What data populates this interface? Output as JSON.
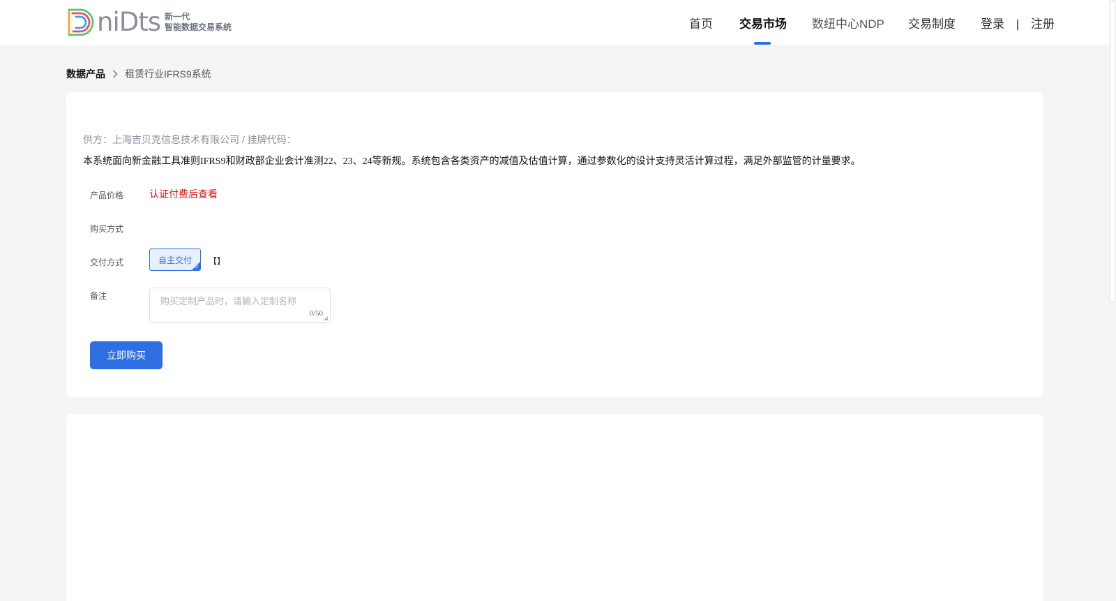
{
  "header": {
    "logo": {
      "word": "niDts",
      "tagline_line1": "新一代",
      "tagline_line2": "智能数据交易系统"
    },
    "nav": [
      {
        "label": "首页"
      },
      {
        "label": "交易市场",
        "active": true
      },
      {
        "label": "数纽中心NDP"
      },
      {
        "label": "交易制度"
      }
    ],
    "auth": {
      "login": "登录",
      "separator": "|",
      "register": "注册"
    }
  },
  "breadcrumb": {
    "root": "数据产品",
    "current": "租赁行业IFRS9系统"
  },
  "product": {
    "supplier_line": "供方：上海吉贝克信息技术有限公司 / 挂牌代码：",
    "description": "本系统面向新金融工具准则IFRS9和财政部企业会计准测22、23、24等新规。系统包含各类资产的减值及估值计算，通过参数化的设计支持灵活计算过程，满足外部监管的计量要求。",
    "price_label": "产品价格",
    "price_value": "认证付费后查看",
    "purchase_label": "购买方式",
    "delivery_label": "交付方式",
    "delivery_option": "自主交付",
    "delivery_extra": "【】",
    "remark_label": "备注",
    "remark_placeholder": "购买定制产品时，请输入定制名称",
    "remark_count": "0/50",
    "buy_button": "立即购买"
  },
  "colors": {
    "accent": "#2f6fe4",
    "price_red": "#e3120b",
    "page_bg": "#f4f5f7"
  }
}
